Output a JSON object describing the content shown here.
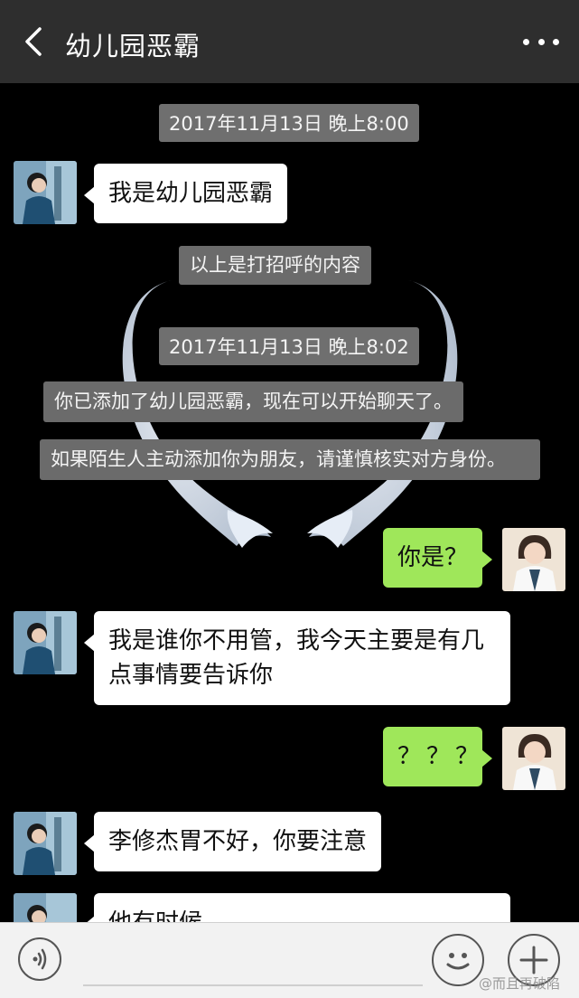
{
  "header": {
    "title": "幼儿园恶霸",
    "back_icon": "chevron-left-icon",
    "more_icon": "more-dots-icon"
  },
  "messages": {
    "ts1": "2017年11月13日 晚上8:00",
    "m1": "我是幼儿园恶霸",
    "sys1": "以上是打招呼的内容",
    "ts2": "2017年11月13日 晚上8:02",
    "sys2": "你已添加了幼儿园恶霸，现在可以开始聊天了。",
    "sys3": "如果陌生人主动添加你为朋友，请谨慎核实对方身份。",
    "m2": "你是？",
    "m3": "我是谁你不用管，我今天主要是有几点事情要告诉你",
    "m4": "？？？",
    "m5": "李修杰胃不好，你要注意",
    "m6": "他有时候"
  },
  "input_bar": {
    "voice_icon": "voice-icon",
    "emoji_icon": "emoji-icon",
    "plus_icon": "plus-icon"
  },
  "watermark": "@而且再破陷",
  "colors": {
    "topbar": "#2e2e2e",
    "chat_bg": "#000000",
    "incoming_bubble": "#ffffff",
    "outgoing_bubble": "#9fe75a",
    "system_tip": "#6b6b6b"
  }
}
